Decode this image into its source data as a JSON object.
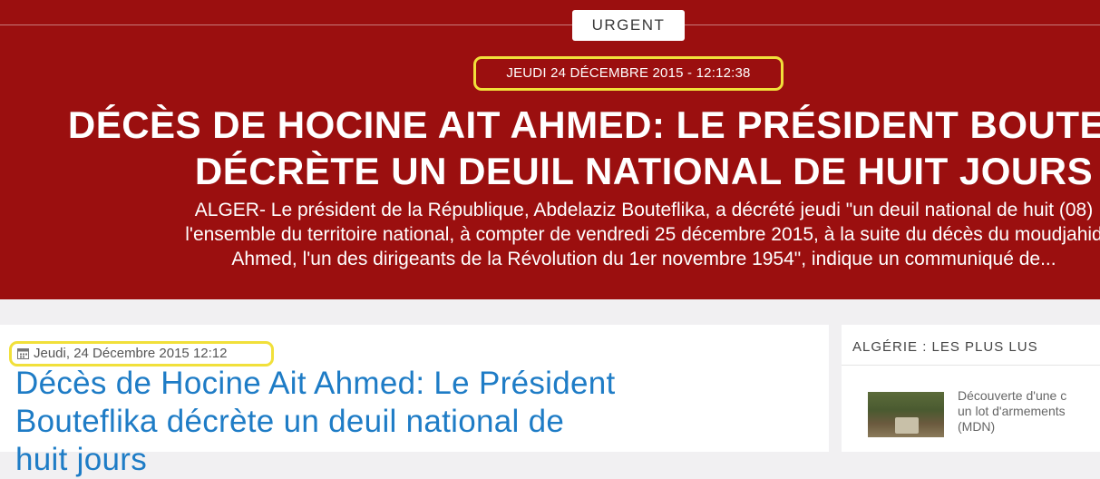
{
  "banner": {
    "badge": "URGENT",
    "date": "JEUDI 24 DÉCEMBRE 2015 - 12:12:38",
    "title_lines": [
      "DÉCÈS DE HOCINE AIT AHMED: LE PRÉSIDENT BOUTEFLIKA",
      "DÉCRÈTE UN DEUIL NATIONAL DE HUIT JOURS"
    ],
    "summary_lines": [
      "ALGER- Le président de la République, Abdelaziz Bouteflika, a décrété jeudi \"un deuil national de huit (08)",
      "l'ensemble du territoire national, à compter de vendredi 25 décembre 2015, à la suite du décès du moudjahid",
      "Ahmed, l'un des dirigeants de la Révolution du 1er novembre 1954\", indique un communiqué de..."
    ]
  },
  "article": {
    "date": "Jeudi, 24 Décembre 2015 12:12",
    "title_lines": [
      "Décès de Hocine Ait Ahmed: Le Président",
      "Bouteflika décrète un deuil national de",
      "huit jours"
    ]
  },
  "sidebar": {
    "heading": "ALGÉRIE : LES PLUS LUS",
    "item_lines": [
      "Découverte d'une c",
      "un lot d'armements",
      "(MDN)"
    ]
  },
  "colors": {
    "banner_red": "#9b0f0f",
    "highlight_yellow": "#f1e03a",
    "title_blue": "#1e7cc6"
  }
}
